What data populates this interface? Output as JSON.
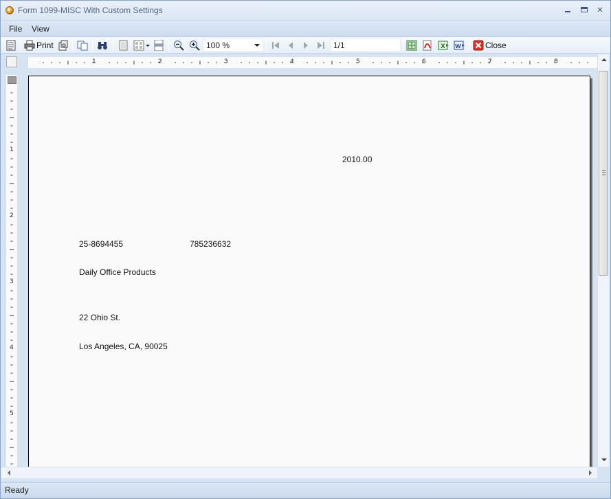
{
  "window": {
    "title": "Form 1099-MISC With Custom Settings"
  },
  "menu": {
    "file": "File",
    "view": "View"
  },
  "toolbar": {
    "print_label": "Print",
    "zoom_value": "100 %",
    "page_value": "1/1",
    "close_label": "Close"
  },
  "ruler": {
    "h_numbers": [
      "1",
      "2",
      "3",
      "4",
      "5",
      "6",
      "7",
      "8"
    ],
    "v_numbers": [
      "1",
      "2",
      "3",
      "4",
      "5"
    ]
  },
  "document": {
    "amount": "2010.00",
    "payer_tin": "25-8694455",
    "recipient_tin": "785236632",
    "recipient_name": "Daily Office Products",
    "street": "22 Ohio St.",
    "city_state_zip": "Los Angeles, CA, 90025"
  },
  "status": {
    "text": "Ready"
  },
  "colors": {
    "chrome": "#d6e3f3",
    "paper": "#fafafa",
    "accent": "#3d5378"
  }
}
